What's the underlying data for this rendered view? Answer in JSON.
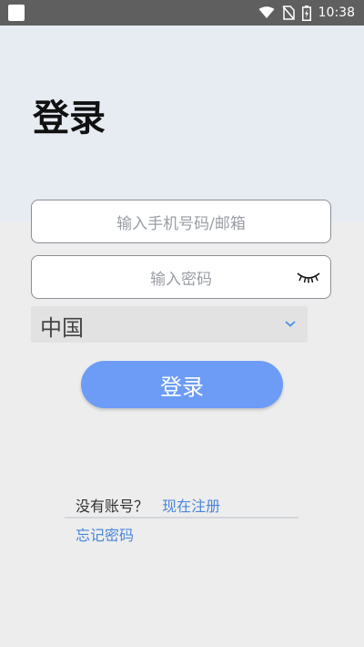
{
  "status_bar": {
    "time": "10:38",
    "icons": [
      "app-notification-icon",
      "wifi-icon",
      "no-sim-icon",
      "battery-charging-icon"
    ]
  },
  "page": {
    "title": "登录"
  },
  "form": {
    "phone_placeholder": "输入手机号码/邮箱",
    "password_placeholder": "输入密码",
    "password_toggle_icon": "eye-closed-icon",
    "country": "中国",
    "country_dropdown_icon": "chevron-down-icon",
    "login_label": "登录"
  },
  "footer": {
    "no_account_prompt": "没有账号？",
    "register_label": "现在注册",
    "forgot_password_label": "忘记密码"
  },
  "colors": {
    "primary_button": "#6c9cf6",
    "link": "#4a86d9",
    "header_background": "#e7ecf2",
    "page_background": "#ededed"
  }
}
